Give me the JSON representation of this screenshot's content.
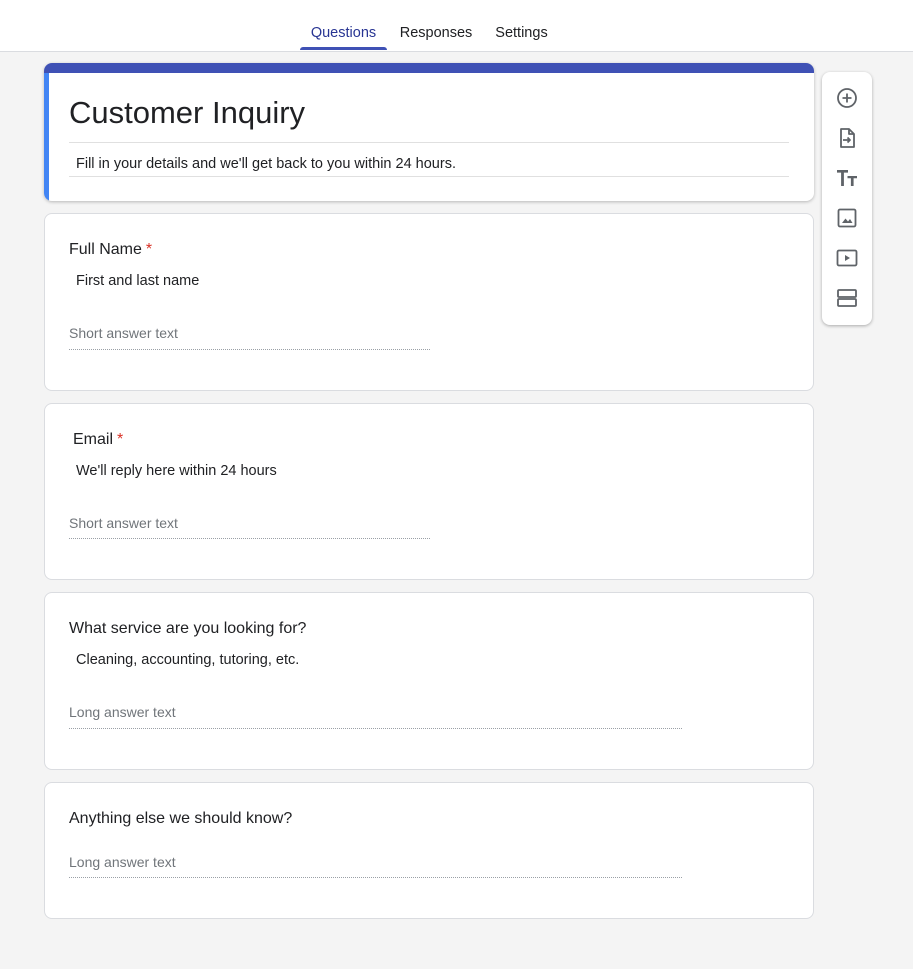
{
  "tabs": [
    {
      "label": "Questions",
      "active": true
    },
    {
      "label": "Responses",
      "active": false
    },
    {
      "label": "Settings",
      "active": false
    }
  ],
  "form": {
    "title": "Customer Inquiry",
    "description": "Fill in your details and we'll get back to you within 24 hours."
  },
  "questions": [
    {
      "title": "Full Name",
      "required": true,
      "required_mark": "*",
      "description": "First and last name",
      "answer_placeholder": "Short answer text",
      "type": "short"
    },
    {
      "title": "Email",
      "required": true,
      "required_mark": "*",
      "description": "We'll reply here within 24 hours",
      "answer_placeholder": "Short answer text",
      "type": "short"
    },
    {
      "title": "What service are you looking for?",
      "required": false,
      "description": "Cleaning, accounting, tutoring, etc.",
      "answer_placeholder": "Long answer text",
      "type": "long"
    },
    {
      "title": "Anything else we should know?",
      "required": false,
      "answer_placeholder": "Long answer text",
      "type": "long"
    }
  ],
  "toolbar": {
    "icons": [
      "add-question-icon",
      "import-questions-icon",
      "add-title-icon",
      "add-image-icon",
      "add-video-icon",
      "add-section-icon"
    ]
  },
  "colors": {
    "accent": "#3f51b5",
    "accent_left_band": "#4285f4",
    "active_tab_text": "#283593",
    "required": "#d93025",
    "background": "#f4f4f4"
  }
}
